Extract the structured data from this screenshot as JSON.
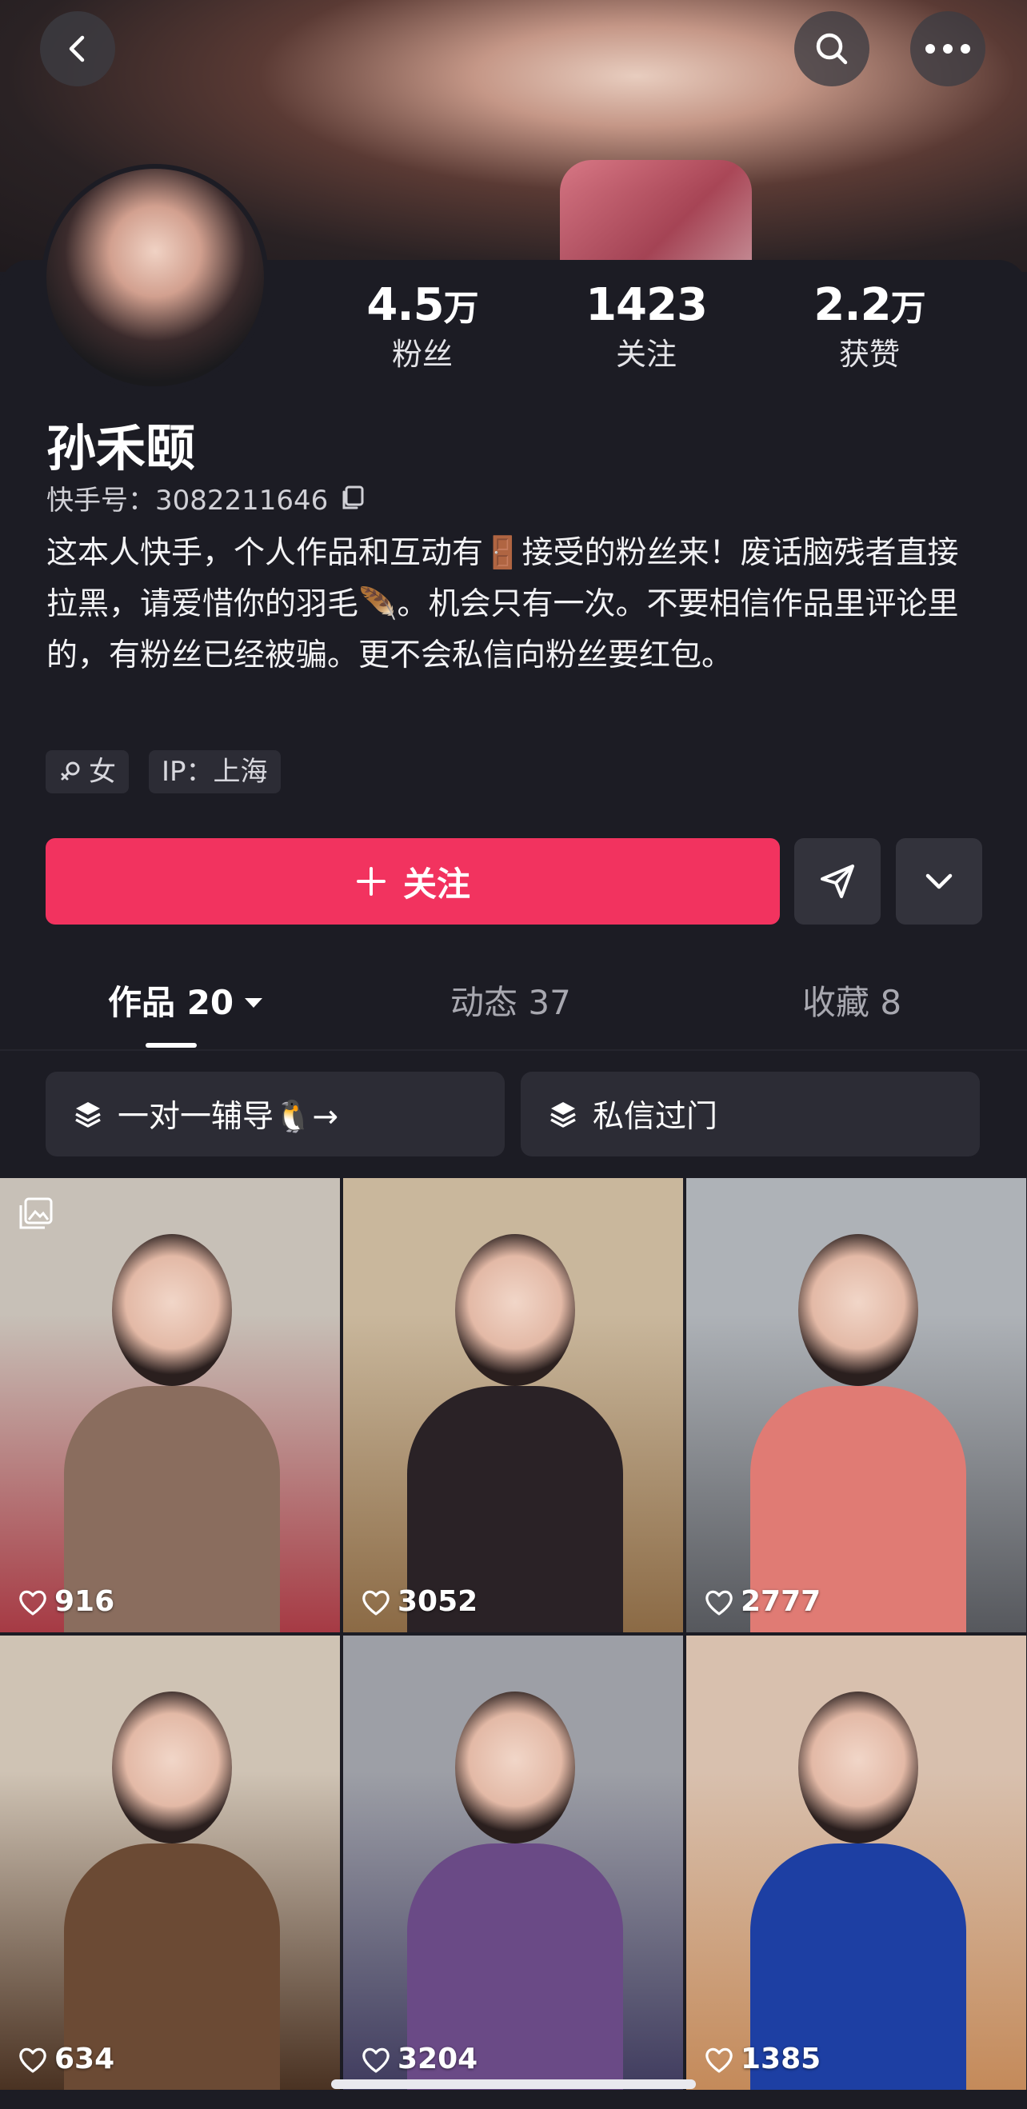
{
  "header": {
    "back_icon": "back-chevron-icon",
    "search_icon": "search-icon",
    "more_icon": "more-dots-icon"
  },
  "profile": {
    "stats": [
      {
        "value": "4.5",
        "unit": "万",
        "label": "粉丝"
      },
      {
        "value": "1423",
        "unit": "",
        "label": "关注"
      },
      {
        "value": "2.2",
        "unit": "万",
        "label": "获赞"
      }
    ],
    "name": "孙禾颐",
    "kuaishou_id_label": "快手号：3082211646",
    "bio": "这本人快手，个人作品和互动有🚪接受的粉丝来！废话脑残者直接拉黑，请爱惜你的羽毛🪶。机会只有一次。不要相信作品里评论里的，有粉丝已经被骗。更不会私信向粉丝要红包。",
    "tags": [
      "女",
      "IP：上海"
    ]
  },
  "actions": {
    "follow_label": "关注"
  },
  "tabs": [
    {
      "label": "作品 20",
      "active": true
    },
    {
      "label": "动态 37",
      "active": false
    },
    {
      "label": "收藏 8",
      "active": false
    }
  ],
  "chips": [
    {
      "label": "一对一辅导🐧→"
    },
    {
      "label": "私信过门"
    }
  ],
  "videos": [
    {
      "likes": "916",
      "palette": [
        "#c7c0b7",
        "#8a6d5e",
        "#a63a44"
      ]
    },
    {
      "likes": "3052",
      "palette": [
        "#c9b79c",
        "#2a2226",
        "#8b6a45"
      ]
    },
    {
      "likes": "2777",
      "palette": [
        "#aeb2b7",
        "#e07b74",
        "#56585d"
      ]
    },
    {
      "likes": "634",
      "palette": [
        "#cfc3b4",
        "#6b4a34",
        "#4a3222"
      ]
    },
    {
      "likes": "3204",
      "palette": [
        "#9d9fa6",
        "#6a4a86",
        "#3f3b5e"
      ]
    },
    {
      "likes": "1385",
      "palette": [
        "#d8c0ae",
        "#1d3fa3",
        "#c48a5a"
      ]
    }
  ],
  "colors": {
    "accent": "#f2335f",
    "background": "#1c1c24",
    "surface": "#2c2c35"
  }
}
